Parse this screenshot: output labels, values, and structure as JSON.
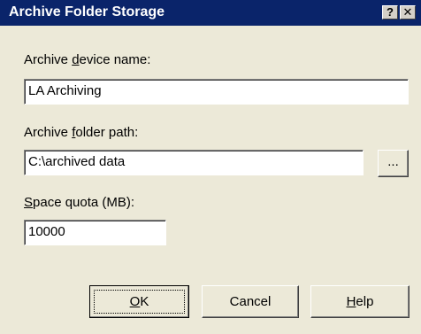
{
  "window": {
    "title": "Archive Folder Storage",
    "help_glyph": "?",
    "close_glyph": "✕"
  },
  "fields": {
    "device_name": {
      "label_pre": "Archive ",
      "label_accel": "d",
      "label_post": "evice name:",
      "value": "LA Archiving"
    },
    "folder_path": {
      "label_pre": "Archive ",
      "label_accel": "f",
      "label_post": "older path:",
      "value": "C:\\archived data",
      "browse_label": "..."
    },
    "quota": {
      "label_pre": "",
      "label_accel": "S",
      "label_post": "pace quota (MB):",
      "value": "10000"
    }
  },
  "buttons": {
    "ok_accel": "O",
    "ok_rest": "K",
    "cancel": "Cancel",
    "help_accel": "H",
    "help_rest": "elp"
  }
}
